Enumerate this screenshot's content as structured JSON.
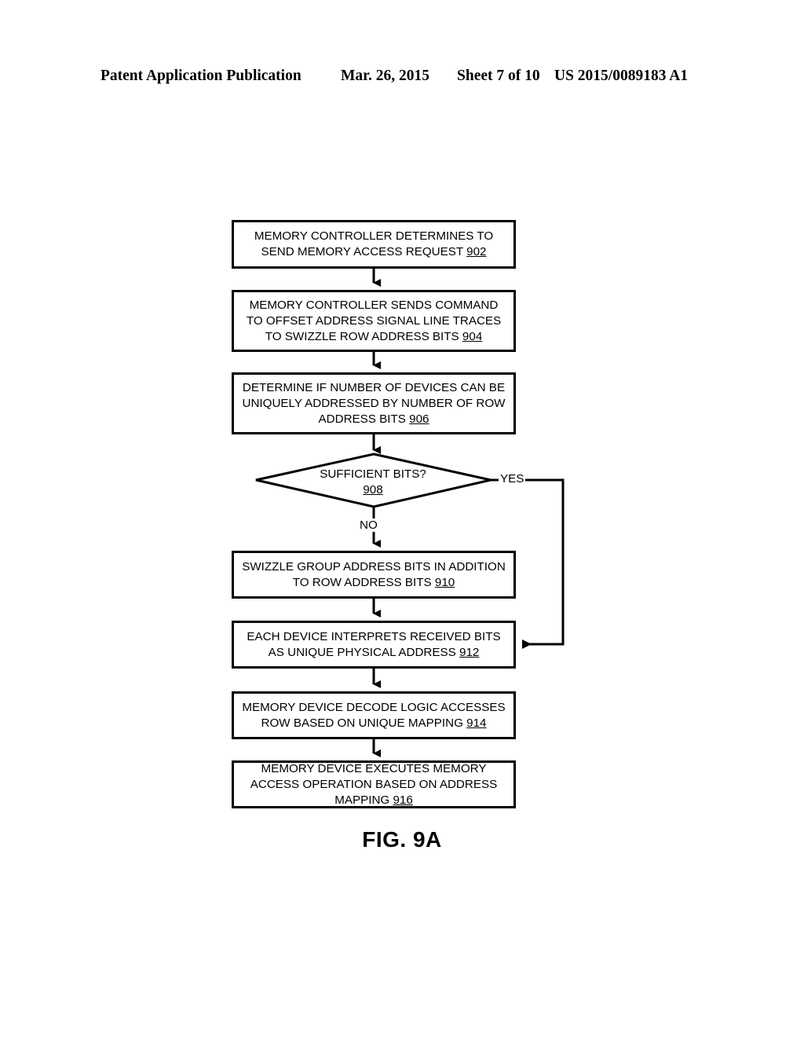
{
  "header": {
    "publication": "Patent Application Publication",
    "date": "Mar. 26, 2015",
    "sheet": "Sheet 7 of 10",
    "document_number": "US 2015/0089183 A1"
  },
  "figure": {
    "caption": "FIG. 9A",
    "type": "flowchart"
  },
  "flowchart": {
    "nodes": [
      {
        "id": "902",
        "shape": "process",
        "text": "MEMORY CONTROLLER DETERMINES TO SEND MEMORY ACCESS REQUEST",
        "ref": "902"
      },
      {
        "id": "904",
        "shape": "process",
        "text": "MEMORY CONTROLLER SENDS COMMAND TO OFFSET ADDRESS SIGNAL LINE TRACES TO SWIZZLE ROW ADDRESS BITS",
        "ref": "904"
      },
      {
        "id": "906",
        "shape": "process",
        "text": "DETERMINE IF NUMBER OF DEVICES CAN BE UNIQUELY ADDRESSED BY NUMBER OF ROW ADDRESS BITS",
        "ref": "906"
      },
      {
        "id": "908",
        "shape": "decision",
        "text": "SUFFICIENT BITS?",
        "ref": "908"
      },
      {
        "id": "910",
        "shape": "process",
        "text": "SWIZZLE GROUP ADDRESS BITS IN ADDITION TO ROW ADDRESS BITS",
        "ref": "910"
      },
      {
        "id": "912",
        "shape": "process",
        "text": "EACH DEVICE INTERPRETS RECEIVED BITS AS UNIQUE PHYSICAL ADDRESS",
        "ref": "912"
      },
      {
        "id": "914",
        "shape": "process",
        "text": "MEMORY DEVICE DECODE LOGIC ACCESSES ROW BASED ON UNIQUE MAPPING",
        "ref": "914"
      },
      {
        "id": "916",
        "shape": "process",
        "text": "MEMORY DEVICE EXECUTES MEMORY ACCESS OPERATION BASED ON ADDRESS MAPPING",
        "ref": "916"
      }
    ],
    "branch_labels": {
      "yes": "YES",
      "no": "NO"
    },
    "edges": [
      {
        "from": "902",
        "to": "904",
        "label": ""
      },
      {
        "from": "904",
        "to": "906",
        "label": ""
      },
      {
        "from": "906",
        "to": "908",
        "label": ""
      },
      {
        "from": "908",
        "to": "910",
        "label": "NO"
      },
      {
        "from": "908",
        "to": "912",
        "label": "YES"
      },
      {
        "from": "910",
        "to": "912",
        "label": ""
      },
      {
        "from": "912",
        "to": "914",
        "label": ""
      },
      {
        "from": "914",
        "to": "916",
        "label": ""
      }
    ]
  },
  "colors": {
    "ink": "#000000",
    "paper": "#ffffff"
  }
}
